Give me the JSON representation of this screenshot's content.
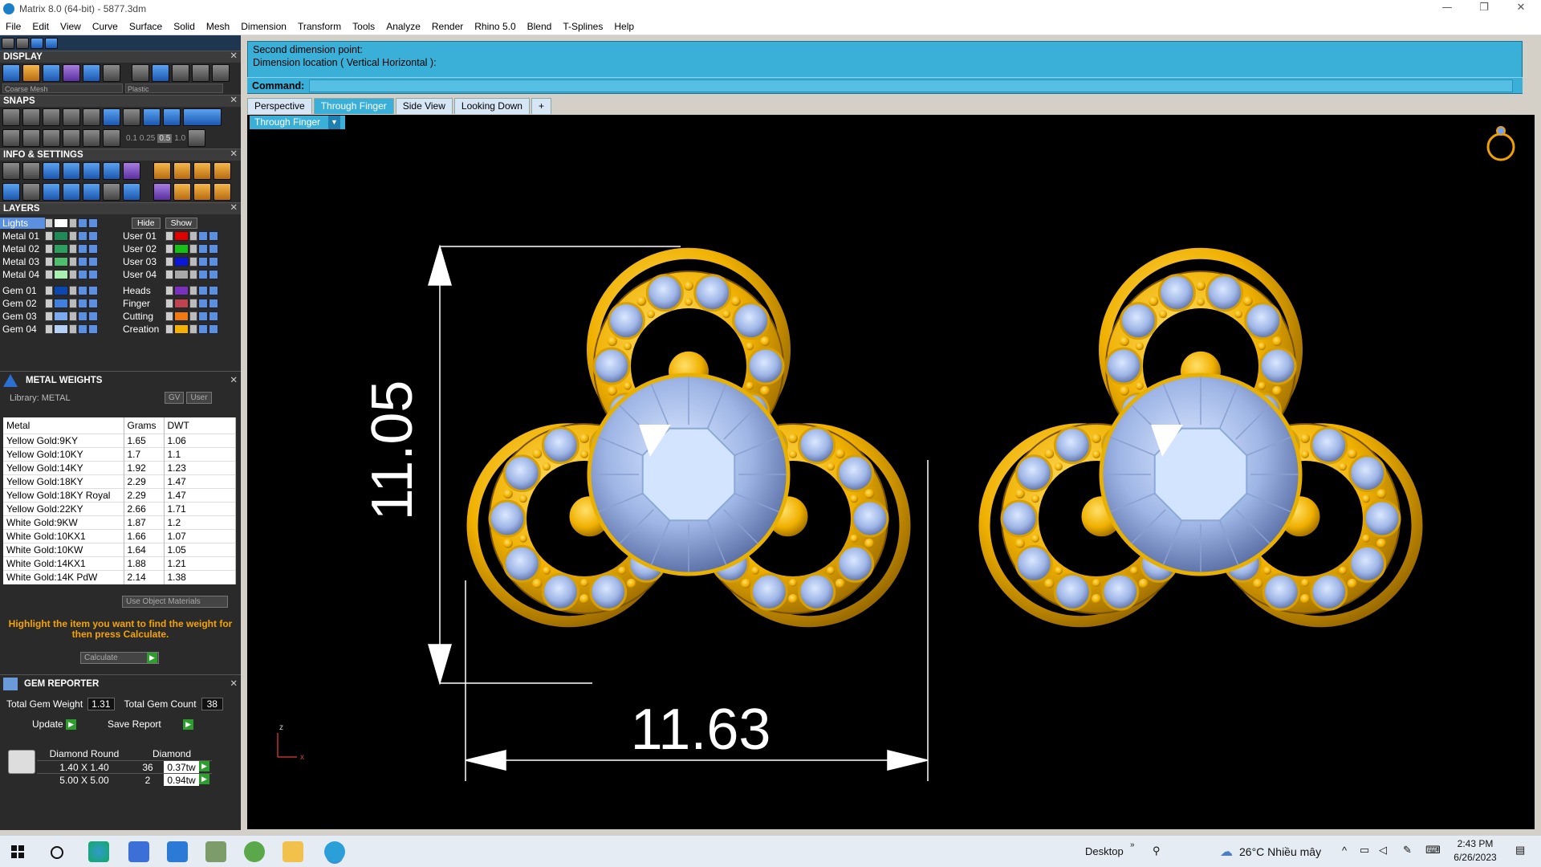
{
  "window": {
    "title": "Matrix 8.0 (64-bit) - 5877.3dm",
    "minimize": "—",
    "restore": "❐",
    "close": "✕"
  },
  "menu": [
    "File",
    "Edit",
    "View",
    "Curve",
    "Surface",
    "Solid",
    "Mesh",
    "Dimension",
    "Transform",
    "Tools",
    "Analyze",
    "Render",
    "Rhino 5.0",
    "Blend",
    "T-Splines",
    "Help"
  ],
  "display": {
    "title": "DISPLAY",
    "mesh": "Coarse Mesh",
    "material": "Plastic"
  },
  "snaps": {
    "title": "SNAPS",
    "values": [
      "0.1",
      "0.25",
      "0.5",
      "1.0"
    ]
  },
  "info": {
    "title": "INFO & SETTINGS"
  },
  "layers": {
    "title": "LAYERS",
    "hide": "Hide",
    "show": "Show",
    "lights": "Lights",
    "left": [
      {
        "name": "Metal 01",
        "color": "#1f8a57"
      },
      {
        "name": "Metal 02",
        "color": "#2da060"
      },
      {
        "name": "Metal 03",
        "color": "#4fbf6e"
      },
      {
        "name": "Metal 04",
        "color": "#a9efb0"
      },
      {
        "name": "Gem 01",
        "color": "#0b47b0"
      },
      {
        "name": "Gem 02",
        "color": "#3f7fe0"
      },
      {
        "name": "Gem 03",
        "color": "#7aa9f0"
      },
      {
        "name": "Gem 04",
        "color": "#b5cff5"
      }
    ],
    "right": [
      {
        "name": "User 01",
        "color": "#e00000"
      },
      {
        "name": "User 02",
        "color": "#16c016"
      },
      {
        "name": "User 03",
        "color": "#0a16d8"
      },
      {
        "name": "User 04",
        "color": "#a8a8a8"
      },
      {
        "name": "Heads",
        "color": "#7b2fbf"
      },
      {
        "name": "Finger",
        "color": "#c0434f"
      },
      {
        "name": "Cutting",
        "color": "#f07a10"
      },
      {
        "name": "Creation",
        "color": "#f5b000"
      }
    ]
  },
  "metal_weights": {
    "title": "METAL WEIGHTS",
    "library": "Library: METAL",
    "gv": "GV",
    "user": "User",
    "headers": [
      "Metal",
      "Grams",
      "DWT"
    ],
    "rows": [
      [
        "Yellow Gold:9KY",
        "1.65",
        "1.06"
      ],
      [
        "Yellow Gold:10KY",
        "1.7",
        "1.1"
      ],
      [
        "Yellow Gold:14KY",
        "1.92",
        "1.23"
      ],
      [
        "Yellow Gold:18KY",
        "2.29",
        "1.47"
      ],
      [
        "Yellow Gold:18KY Royal",
        "2.29",
        "1.47"
      ],
      [
        "Yellow Gold:22KY",
        "2.66",
        "1.71"
      ],
      [
        "White Gold:9KW",
        "1.87",
        "1.2"
      ],
      [
        "White Gold:10KX1",
        "1.66",
        "1.07"
      ],
      [
        "White Gold:10KW",
        "1.64",
        "1.05"
      ],
      [
        "White Gold:14KX1",
        "1.88",
        "1.21"
      ],
      [
        "White Gold:14K PdW",
        "2.14",
        "1.38"
      ]
    ],
    "use_object_materials": "Use Object Materials",
    "note": "Highlight the item you want to find the weight for then press Calculate.",
    "calculate": "Calculate"
  },
  "gem_reporter": {
    "title": "GEM REPORTER",
    "total_weight_label": "Total Gem Weight",
    "total_weight": "1.31",
    "total_count_label": "Total Gem Count",
    "total_count": "38",
    "update": "Update",
    "save_report": "Save Report",
    "col1": "Diamond Round",
    "col2": "Diamond",
    "rows": [
      [
        "1.40 X 1.40",
        "36",
        "0.37tw"
      ],
      [
        "5.00 X 5.00",
        "2",
        "0.94tw"
      ]
    ]
  },
  "command": {
    "line1": "Second dimension point:",
    "line2": "Dimension location ( Vertical  Horizontal ):",
    "label": "Command:"
  },
  "tabs": [
    "Perspective",
    "Through Finger",
    "Side View",
    "Looking Down",
    "+"
  ],
  "active_tab": "Through Finger",
  "viewport": {
    "label": "Through Finger",
    "dim_vertical": "11.05",
    "dim_horizontal": "11.63",
    "axis_z": "z",
    "axis_x": "x"
  },
  "taskbar": {
    "desktop": "Desktop",
    "weather": "26°C  Nhiều mây",
    "time": "2:43 PM",
    "date": "6/26/2023"
  }
}
